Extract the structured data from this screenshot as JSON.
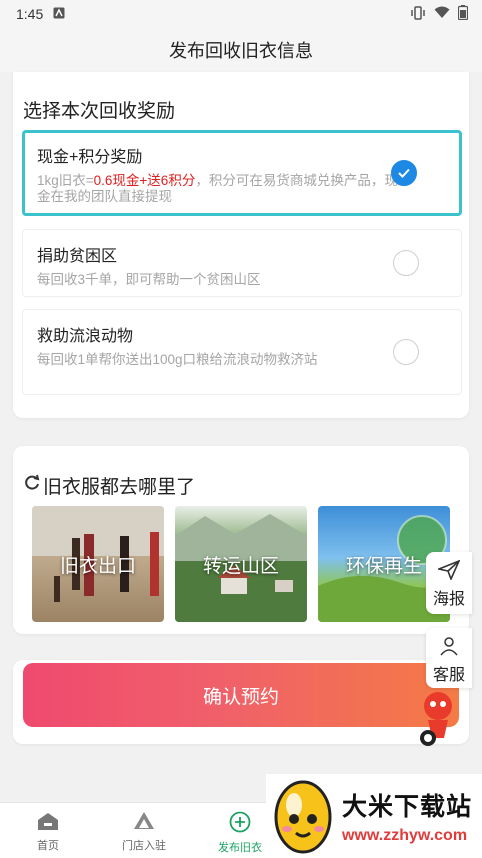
{
  "status": {
    "time": "1:45",
    "left_icon": "a-square-icon",
    "right_icons": [
      "vibrate-icon",
      "wifi-icon",
      "battery-icon"
    ]
  },
  "header": {
    "title": "发布回收旧衣信息"
  },
  "reward": {
    "title": "选择本次回收奖励",
    "options": [
      {
        "title": "现金+积分奖励",
        "desc_prefix": "1kg旧衣=",
        "desc_highlight": "0.6现金+送6积分",
        "desc_suffix": "，积分可在易货商城兑换产品，现金在我的团队直接提现",
        "selected": true
      },
      {
        "title": "捐助贫困区",
        "desc": "每回收3千单，即可帮助一个贫困山区",
        "selected": false
      },
      {
        "title": "救助流浪动物",
        "desc": "每回收1单帮你送出100g口粮给流浪动物救济站",
        "selected": false
      }
    ]
  },
  "where": {
    "title": "旧衣服都去哪里了",
    "cards": [
      {
        "label": "旧衣出口"
      },
      {
        "label": "转运山区"
      },
      {
        "label": "环保再生"
      }
    ]
  },
  "confirm": {
    "label": "确认预约"
  },
  "floating": {
    "poster": "海报",
    "service": "客服"
  },
  "tabs": [
    {
      "label": "首页",
      "icon": "home-icon"
    },
    {
      "label": "门店入驻",
      "icon": "store-icon"
    },
    {
      "label": "发布旧衣",
      "icon": "add-circle-icon",
      "active": true
    }
  ],
  "watermark": {
    "name": "大米下载站",
    "url": "www.zzhyw.com"
  },
  "colors": {
    "accent": "#3cc2cc",
    "check": "#1e88e5",
    "highlight": "#e02020",
    "button_start": "#ef4a6e",
    "button_end": "#f47b45"
  }
}
